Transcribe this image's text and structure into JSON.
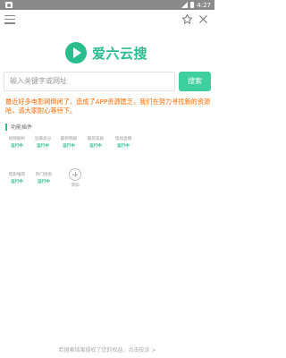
{
  "statusbar": {
    "time": "4:27"
  },
  "header": {
    "menu_icon": "menu-icon",
    "star_icon": "star-icon",
    "close_icon": "close-icon"
  },
  "logo": {
    "text": "爱六云搜",
    "icon": "play-icon"
  },
  "search": {
    "placeholder": "输入关键字或网址",
    "button_label": "搜索"
  },
  "notice": "最近好多电影网倒闭了，造成了APP资源匮乏，我们在努力寻找新的资源哈，请大家耐心等待下。",
  "plugins_section": {
    "title": "功能插件",
    "items": [
      {
        "name": "视频解析",
        "status": "运行中"
      },
      {
        "name": "豆瓣高分",
        "status": "运行中"
      },
      {
        "name": "最新韩剧",
        "status": "运行中"
      },
      {
        "name": "最新美剧",
        "status": "运行中"
      },
      {
        "name": "电视直播",
        "status": "运行中"
      },
      {
        "name": "电影推荐",
        "status": "运行中"
      },
      {
        "name": "热门搜索",
        "status": "运行中"
      }
    ],
    "add_label": "添加"
  },
  "footer": "若搜索结果侵权了您的权益，点击投诉 >",
  "colors": {
    "accent": "#29bd8e",
    "button": "#3ecf9e",
    "notice": "#ff6a00",
    "statusbar": "#8a8a8a"
  }
}
